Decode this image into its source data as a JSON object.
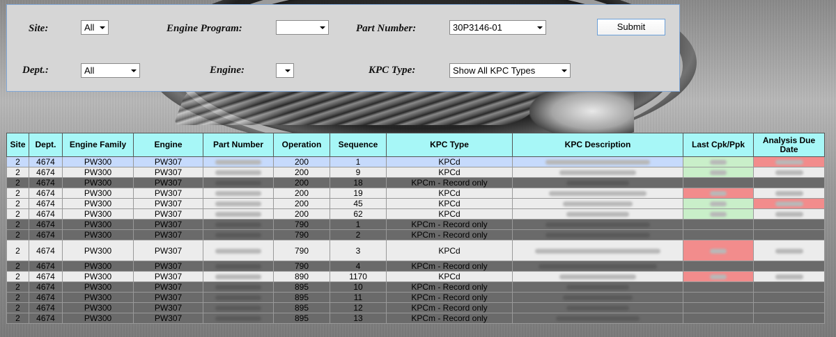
{
  "filters": {
    "site": {
      "label": "Site:",
      "value": "All"
    },
    "engine_program": {
      "label": "Engine Program:",
      "value": ""
    },
    "part_number": {
      "label": "Part Number:",
      "value": "30P3146-01"
    },
    "dept": {
      "label": "Dept.:",
      "value": "All"
    },
    "engine": {
      "label": "Engine:",
      "value": ""
    },
    "kpc_type": {
      "label": "KPC Type:",
      "value": "Show All KPC Types"
    },
    "submit_label": "Submit"
  },
  "table": {
    "headers": [
      "Site",
      "Dept.",
      "Engine Family",
      "Engine",
      "Part Number",
      "Operation",
      "Sequence",
      "KPC Type",
      "KPC Description",
      "Last Cpk/Ppk",
      "Analysis Due Date"
    ],
    "rows": [
      {
        "site": "2",
        "dept": "4674",
        "family": "PW300",
        "engine": "PW307",
        "operation": "200",
        "sequence": "1",
        "kpc_type": "KPCd"
      },
      {
        "site": "2",
        "dept": "4674",
        "family": "PW300",
        "engine": "PW307",
        "operation": "200",
        "sequence": "9",
        "kpc_type": "KPCd"
      },
      {
        "site": "2",
        "dept": "4674",
        "family": "PW300",
        "engine": "PW307",
        "operation": "200",
        "sequence": "18",
        "kpc_type": "KPCm - Record only"
      },
      {
        "site": "2",
        "dept": "4674",
        "family": "PW300",
        "engine": "PW307",
        "operation": "200",
        "sequence": "19",
        "kpc_type": "KPCd"
      },
      {
        "site": "2",
        "dept": "4674",
        "family": "PW300",
        "engine": "PW307",
        "operation": "200",
        "sequence": "45",
        "kpc_type": "KPCd"
      },
      {
        "site": "2",
        "dept": "4674",
        "family": "PW300",
        "engine": "PW307",
        "operation": "200",
        "sequence": "62",
        "kpc_type": "KPCd"
      },
      {
        "site": "2",
        "dept": "4674",
        "family": "PW300",
        "engine": "PW307",
        "operation": "790",
        "sequence": "1",
        "kpc_type": "KPCm - Record only"
      },
      {
        "site": "2",
        "dept": "4674",
        "family": "PW300",
        "engine": "PW307",
        "operation": "790",
        "sequence": "2",
        "kpc_type": "KPCm - Record only"
      },
      {
        "site": "2",
        "dept": "4674",
        "family": "PW300",
        "engine": "PW307",
        "operation": "790",
        "sequence": "3",
        "kpc_type": "KPCd"
      },
      {
        "site": "2",
        "dept": "4674",
        "family": "PW300",
        "engine": "PW307",
        "operation": "790",
        "sequence": "4",
        "kpc_type": "KPCm - Record only"
      },
      {
        "site": "2",
        "dept": "4674",
        "family": "PW300",
        "engine": "PW307",
        "operation": "890",
        "sequence": "1170",
        "kpc_type": "KPCd"
      },
      {
        "site": "2",
        "dept": "4674",
        "family": "PW300",
        "engine": "PW307",
        "operation": "895",
        "sequence": "10",
        "kpc_type": "KPCm - Record only"
      },
      {
        "site": "2",
        "dept": "4674",
        "family": "PW300",
        "engine": "PW307",
        "operation": "895",
        "sequence": "11",
        "kpc_type": "KPCm - Record only"
      },
      {
        "site": "2",
        "dept": "4674",
        "family": "PW300",
        "engine": "PW307",
        "operation": "895",
        "sequence": "12",
        "kpc_type": "KPCm - Record only"
      },
      {
        "site": "2",
        "dept": "4674",
        "family": "PW300",
        "engine": "PW307",
        "operation": "895",
        "sequence": "13",
        "kpc_type": "KPCm - Record only"
      }
    ]
  }
}
